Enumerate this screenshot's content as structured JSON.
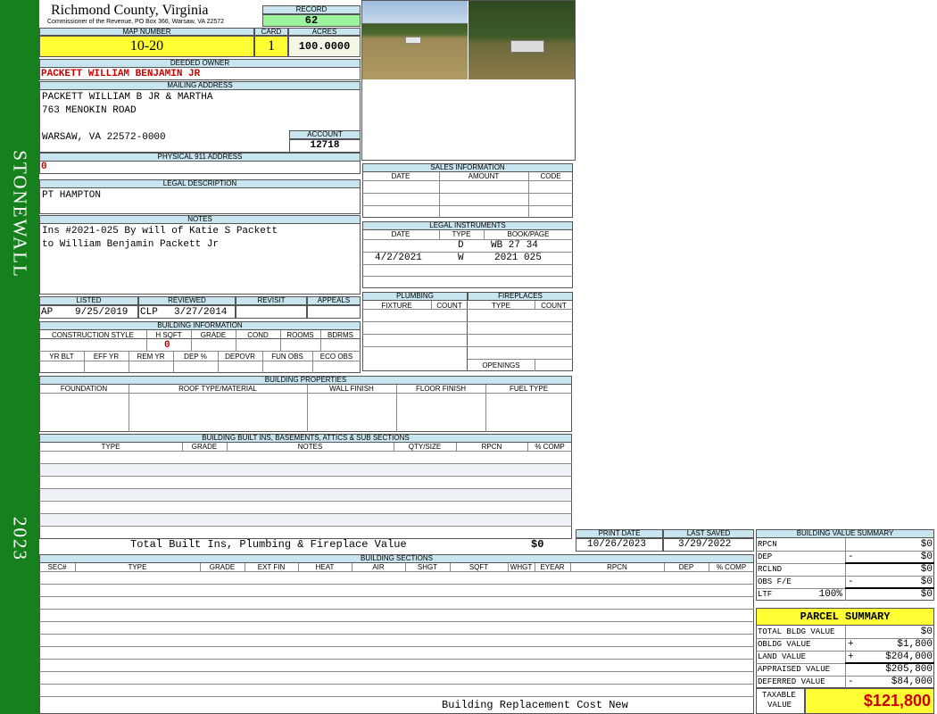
{
  "sidebar": {
    "district": "STONEWALL",
    "year": "2023"
  },
  "header": {
    "county": "Richmond County, Virginia",
    "commissioner": "Commissioner of the Revenue, PO Box 366, Warsaw, VA 22572",
    "record_label": "RECORD",
    "record": "62",
    "map_number_label": "MAP NUMBER",
    "map_number": "10-20",
    "card_label": "CARD",
    "card": "1",
    "acres_label": "ACRES",
    "acres": "100.0000"
  },
  "owner": {
    "deeded_owner_label": "DEEDED OWNER",
    "deeded_owner": "PACKETT WILLIAM BENJAMIN JR",
    "mailing_address_label": "MAILING ADDRESS",
    "mailing_line1": "PACKETT WILLIAM B JR & MARTHA",
    "mailing_line2": "763 MENOKIN ROAD",
    "mailing_line3": "WARSAW, VA 22572-0000",
    "account_label": "ACCOUNT",
    "account": "12718",
    "physical_label": "PHYSICAL 911 ADDRESS",
    "physical": "0"
  },
  "legal": {
    "label": "LEGAL DESCRIPTION",
    "value": "PT HAMPTON"
  },
  "notes": {
    "label": "NOTES",
    "line1": "Ins #2021-025 By will of Katie S Packett",
    "line2": "to William Benjamin Packett Jr"
  },
  "review": {
    "listed_label": "LISTED",
    "reviewed_label": "REVIEWED",
    "revisit_label": "REVISIT",
    "appeals_label": "APPEALS",
    "listed_by": "AP",
    "listed_date": "9/25/2019",
    "reviewed_by": "CLP",
    "reviewed_date": "3/27/2014"
  },
  "building_info": {
    "label": "BUILDING INFORMATION",
    "cols1": [
      "CONSTRUCTION STYLE",
      "H SQFT",
      "GRADE",
      "COND",
      "ROOMS",
      "BDRMS"
    ],
    "hsqft": "0",
    "cols2": [
      "YR BLT",
      "EFF YR",
      "REM YR",
      "DEP %",
      "DEPOVR",
      "FUN OBS",
      "ECO OBS"
    ]
  },
  "sales": {
    "label": "SALES INFORMATION",
    "cols": [
      "DATE",
      "AMOUNT",
      "CODE"
    ]
  },
  "instruments": {
    "label": "LEGAL INSTRUMENTS",
    "cols": [
      "DATE",
      "TYPE",
      "BOOK/PAGE"
    ],
    "rows": [
      {
        "date": "",
        "type": "D",
        "book": "WB 27 34"
      },
      {
        "date": "4/2/2021",
        "type": "W",
        "book": "2021 025"
      }
    ]
  },
  "plumbing": {
    "label": "PLUMBING",
    "cols": [
      "FIXTURE",
      "COUNT"
    ]
  },
  "fireplaces": {
    "label": "FIREPLACES",
    "cols": [
      "TYPE",
      "COUNT"
    ],
    "openings_label": "OPENINGS"
  },
  "properties": {
    "label": "BUILDING PROPERTIES",
    "cols": [
      "FOUNDATION",
      "ROOF TYPE/MATERIAL",
      "WALL FINISH",
      "FLOOR FINISH",
      "FUEL TYPE"
    ]
  },
  "builtins": {
    "label": "BUILDING BUILT INS, BASEMENTS, ATTICS & SUB SECTIONS",
    "cols": [
      "TYPE",
      "GRADE",
      "NOTES",
      "QTY/SIZE",
      "RPCN",
      "% COMP"
    ],
    "total_label": "Total Built Ins, Plumbing & Fireplace Value",
    "total": "$0"
  },
  "dates": {
    "print_label": "PRINT DATE",
    "print": "10/26/2023",
    "saved_label": "LAST SAVED",
    "saved": "3/29/2022"
  },
  "sections": {
    "label": "BUILDING SECTIONS",
    "cols": [
      "SEC#",
      "TYPE",
      "GRADE",
      "EXT FIN",
      "HEAT",
      "AIR",
      "SHGT",
      "SQFT",
      "WHGT",
      "EYEAR",
      "RPCN",
      "DEP",
      "% COMP"
    ],
    "footer": "Building Replacement Cost New"
  },
  "value_summary": {
    "label": "BUILDING VALUE SUMMARY",
    "rows": [
      {
        "name": "RPCN",
        "sign": "",
        "value": "$0"
      },
      {
        "name": "DEP",
        "sign": "-",
        "value": "$0"
      },
      {
        "name": "RCLND",
        "sign": "",
        "value": "$0"
      },
      {
        "name": "OBS F/E",
        "sign": "-",
        "value": "$0"
      },
      {
        "name": "LTF",
        "sign": "100%",
        "value": "$0"
      }
    ]
  },
  "parcel": {
    "label": "PARCEL SUMMARY",
    "rows": [
      {
        "name": "TOTAL BLDG VALUE",
        "sign": "",
        "value": "$0"
      },
      {
        "name": "OBLDG VALUE",
        "sign": "+",
        "value": "$1,800"
      },
      {
        "name": "LAND VALUE",
        "sign": "+",
        "value": "$204,000"
      },
      {
        "name": "APPRAISED VALUE",
        "sign": "",
        "value": "$205,800"
      },
      {
        "name": "DEFERRED VALUE",
        "sign": "-",
        "value": "$84,000"
      }
    ],
    "taxable_label_1": "TAXABLE",
    "taxable_label_2": "VALUE",
    "taxable": "$121,800"
  },
  "colors": {
    "green": "#16801d",
    "label_blue": "#c8e4ee",
    "yellow": "#ffff33",
    "record_green": "#9cf59c",
    "red": "#cc0000"
  }
}
